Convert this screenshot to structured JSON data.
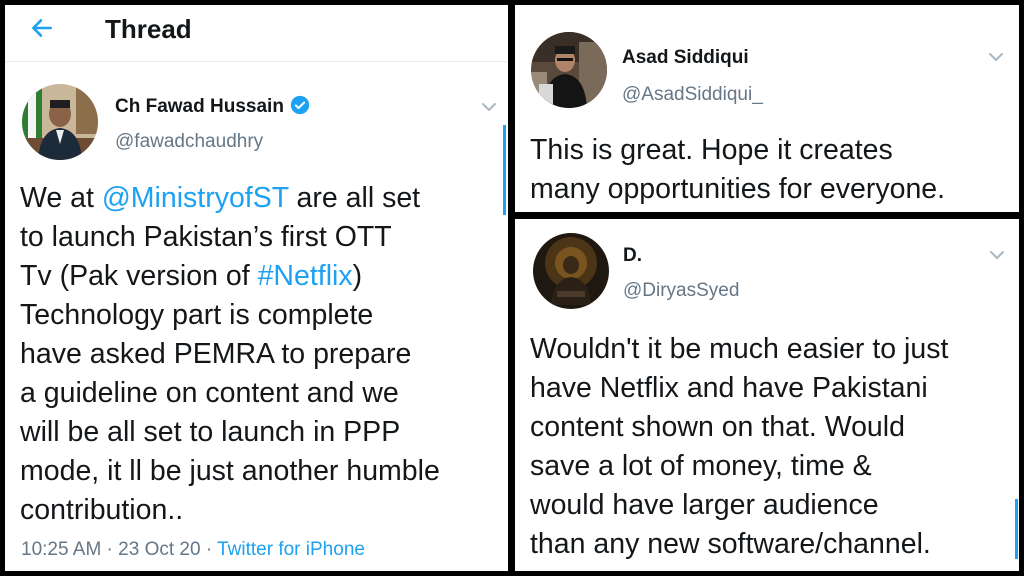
{
  "left_panel": {
    "header": {
      "title": "Thread",
      "back_icon": "arrow-left-icon"
    },
    "tweet": {
      "author_name": "Ch Fawad Hussain",
      "author_handle": "@fawadchaudhry",
      "verified": true,
      "body": {
        "line1_pre": "We at ",
        "mention": "@MinistryofST",
        "line1_post": " are all set",
        "line2": "to launch Pakistan’s first OTT",
        "line3_pre": "Tv (Pak version of ",
        "hashtag": "#Netflix",
        "line3_post": ")",
        "line4": "Technology part is complete",
        "line5": "have asked PEMRA to prepare",
        "line6": "a guideline on content and we",
        "line7": "will be all set to launch in PPP",
        "line8": "mode, it ll be just another humble",
        "line9": "contribution.."
      },
      "time": "10:25 AM",
      "separator": " · ",
      "date": "23 Oct 20",
      "source": "Twitter for iPhone"
    }
  },
  "top_right_panel": {
    "author_name": "Asad Siddiqui",
    "author_handle": "@AsadSiddiqui_",
    "body": {
      "line1": "This is great. Hope it creates",
      "line2": "many opportunities for everyone."
    }
  },
  "bottom_right_panel": {
    "author_name": "D.",
    "author_handle": "@DiryasSyed",
    "body": {
      "line1": "Wouldn't it be much easier to just",
      "line2": "have Netflix and have Pakistani",
      "line3": "content shown on that. Would",
      "line4": "save a lot of money, time &",
      "line5": "would have larger audience",
      "line6": "than any new software/channel."
    }
  },
  "colors": {
    "accent": "#1da1f2",
    "text": "#14171a",
    "secondary": "#657786"
  }
}
